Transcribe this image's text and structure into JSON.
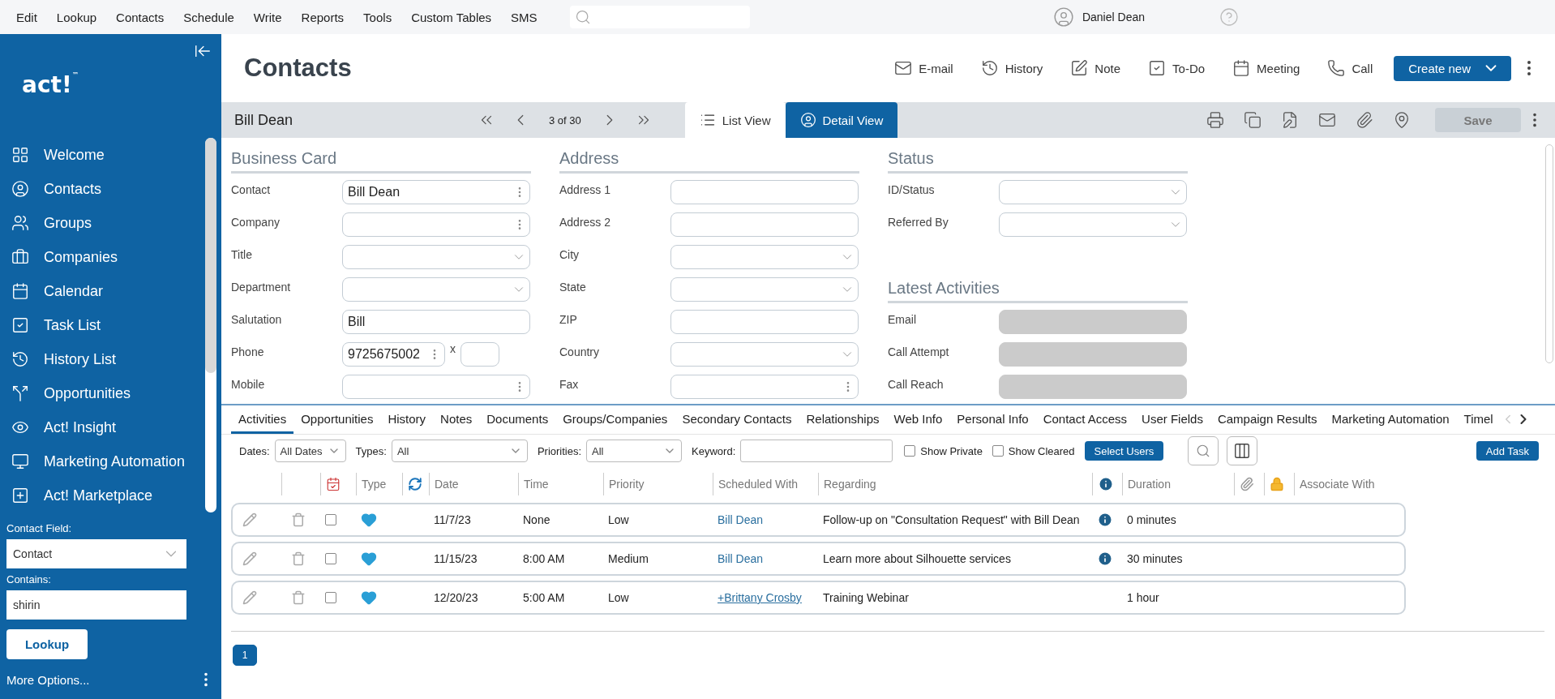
{
  "menu": [
    "Edit",
    "Lookup",
    "Contacts",
    "Schedule",
    "Write",
    "Reports",
    "Tools",
    "Custom Tables",
    "SMS"
  ],
  "user": {
    "name": "Daniel Dean"
  },
  "sidebar": {
    "logo": "act!$^{™}$",
    "items": [
      {
        "kind": "welcome",
        "label": "Welcome"
      },
      {
        "kind": "contacts",
        "label": "Contacts"
      },
      {
        "kind": "groups",
        "label": "Groups"
      },
      {
        "kind": "companies",
        "label": "Companies"
      },
      {
        "kind": "calendar",
        "label": "Calendar"
      },
      {
        "kind": "tasks",
        "label": "Task List"
      },
      {
        "kind": "history",
        "label": "History List"
      },
      {
        "kind": "opportunities",
        "label": "Opportunities"
      },
      {
        "kind": "insight",
        "label": "Act! Insight"
      },
      {
        "kind": "marketing",
        "label": "Marketing Automation"
      },
      {
        "kind": "marketplace",
        "label": "Act! Marketplace"
      }
    ],
    "lookup": {
      "field_label": "Contact Field:",
      "field_value": "Contact",
      "contains_label": "Contains:",
      "contains_value": "shirin",
      "button": "Lookup",
      "more_options": "More Options..."
    }
  },
  "header": {
    "title": "Contacts",
    "actions": [
      {
        "kind": "email",
        "label": "E-mail"
      },
      {
        "kind": "history",
        "label": "History"
      },
      {
        "kind": "note",
        "label": "Note"
      },
      {
        "kind": "todo",
        "label": "To-Do"
      },
      {
        "kind": "meeting",
        "label": "Meeting"
      },
      {
        "kind": "call",
        "label": "Call"
      }
    ],
    "create_button": "Create new"
  },
  "record_bar": {
    "name": "Bill Dean",
    "position": "3 of 30",
    "views": [
      {
        "kind": "list",
        "label": "List View",
        "selected": false
      },
      {
        "kind": "detail",
        "label": "Detail View",
        "selected": true
      }
    ],
    "save": {
      "label": "Save",
      "disabled": true
    }
  },
  "sections": [
    {
      "title": "Business Card",
      "fields": [
        {
          "label": "Contact",
          "kind": "dots",
          "value": "Bill Dean"
        },
        {
          "label": "Company",
          "kind": "dots"
        },
        {
          "label": "Title",
          "kind": "select"
        },
        {
          "label": "Department",
          "kind": "select"
        },
        {
          "label": "Salutation",
          "kind": "text",
          "value": "Bill"
        },
        {
          "label": "Phone",
          "kind": "phone",
          "value": "9725675002",
          "extension_label": "x"
        },
        {
          "label": "Mobile",
          "kind": "dots"
        }
      ]
    },
    {
      "title": "Address",
      "fields": [
        {
          "label": "Address 1",
          "kind": "text"
        },
        {
          "label": "Address 2",
          "kind": "text"
        },
        {
          "label": "City",
          "kind": "select"
        },
        {
          "label": "State",
          "kind": "select"
        },
        {
          "label": "ZIP",
          "kind": "text"
        },
        {
          "label": "Country",
          "kind": "select"
        },
        {
          "label": "Fax",
          "kind": "dots"
        }
      ]
    },
    {
      "title": "Status",
      "fields": [
        {
          "label": "ID/Status",
          "kind": "select"
        },
        {
          "label": "Referred By",
          "kind": "select"
        }
      ]
    },
    {
      "title": "Latest Activities",
      "fields": [
        {
          "label": "Email",
          "kind": "blank"
        },
        {
          "label": "Call Attempt",
          "kind": "blank"
        },
        {
          "label": "Call Reach",
          "kind": "blank"
        }
      ]
    }
  ],
  "tabs": [
    {
      "label": "Activities",
      "selected": true
    },
    {
      "label": "Opportunities",
      "selected": false
    },
    {
      "label": "History",
      "selected": false
    },
    {
      "label": "Notes",
      "selected": false
    },
    {
      "label": "Documents",
      "selected": false
    },
    {
      "label": "Groups/Companies",
      "selected": false
    },
    {
      "label": "Secondary Contacts",
      "selected": false
    },
    {
      "label": "Relationships",
      "selected": false
    },
    {
      "label": "Web Info",
      "selected": false
    },
    {
      "label": "Personal Info",
      "selected": false
    },
    {
      "label": "Contact Access",
      "selected": false
    },
    {
      "label": "User Fields",
      "selected": false
    },
    {
      "label": "Campaign Results",
      "selected": false
    },
    {
      "label": "Marketing Automation",
      "selected": false
    },
    {
      "label": "Timel",
      "selected": false
    }
  ],
  "filters": {
    "dates_label": "Dates:",
    "dates_value": "All Dates",
    "types_label": "Types:",
    "types_value": "All",
    "priorities_label": "Priorities:",
    "priorities_value": "All",
    "keyword_label": "Keyword:",
    "checks": [
      {
        "label": "Show Private",
        "checked": false
      },
      {
        "label": "Show Cleared",
        "checked": false
      }
    ],
    "select_users": "Select Users",
    "add_task": "Add Task"
  },
  "table": {
    "columns": [
      "Type",
      "Date",
      "Time",
      "Priority",
      "Scheduled With",
      "Regarding",
      "Duration",
      "Associate With"
    ],
    "rows": [
      {
        "checked": false,
        "date": "11/7/23",
        "time": "None",
        "priority": "Low",
        "scheduled_with": "Bill Dean",
        "underlined": false,
        "regarding": "Follow-up on \"Consultation Request\" with Bill Dean",
        "info": true,
        "duration": "0 minutes"
      },
      {
        "checked": false,
        "date": "11/15/23",
        "time": "8:00 AM",
        "priority": "Medium",
        "scheduled_with": "Bill Dean",
        "underlined": false,
        "regarding": "Learn more about Silhouette services",
        "info": true,
        "duration": "30 minutes"
      },
      {
        "checked": false,
        "date": "12/20/23",
        "time": "5:00 AM",
        "priority": "Low",
        "scheduled_with": "+Brittany Crosby",
        "underlined": true,
        "regarding": "Training Webinar",
        "info": false,
        "duration": "1 hour"
      }
    ]
  },
  "pagination": [
    {
      "label": "1",
      "selected": true
    }
  ]
}
